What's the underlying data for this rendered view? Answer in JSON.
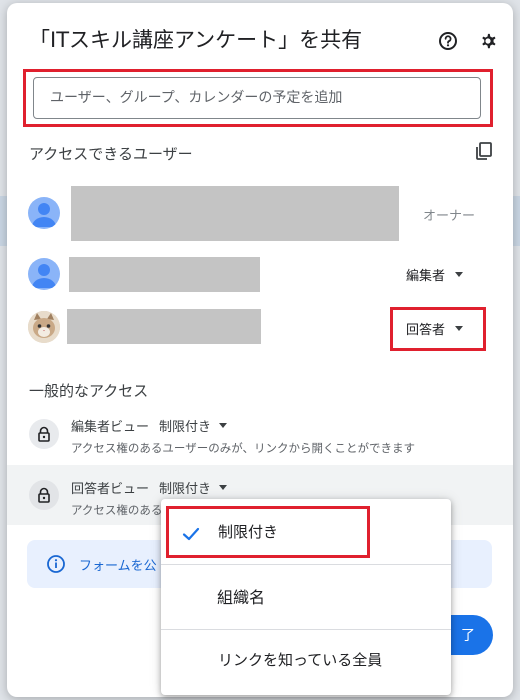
{
  "dialog": {
    "title": "「ITスキル講座アンケート」を共有"
  },
  "search": {
    "placeholder": "ユーザー、グループ、カレンダーの予定を追加"
  },
  "people_section": {
    "heading": "アクセスできるユーザー",
    "members": [
      {
        "role": "オーナー"
      },
      {
        "role": "編集者"
      },
      {
        "role": "回答者"
      }
    ]
  },
  "general_access": {
    "heading": "一般的なアクセス",
    "rows": [
      {
        "label": "編集者ビュー",
        "setting": "制限付き",
        "description": "アクセス権のあるユーザーのみが、リンクから開くことができます"
      },
      {
        "label": "回答者ビュー",
        "setting": "制限付き",
        "description": "アクセス権のある"
      }
    ]
  },
  "info_banner": {
    "text": "フォームを公"
  },
  "done_button": {
    "label": "了"
  },
  "dropdown_menu": {
    "items": [
      {
        "label": "制限付き",
        "selected": true
      },
      {
        "label": "組織名",
        "selected": false
      },
      {
        "label": "リンクを知っている全員",
        "selected": false
      }
    ]
  },
  "colors": {
    "accent": "#1a73e8",
    "highlight_border": "#e0202e",
    "avatar_blue": "#8ab4f8"
  },
  "icons": [
    "help-icon",
    "gear-icon",
    "copy-icon",
    "person-icon",
    "lock-icon",
    "info-icon",
    "check-icon",
    "caret-down-icon"
  ]
}
